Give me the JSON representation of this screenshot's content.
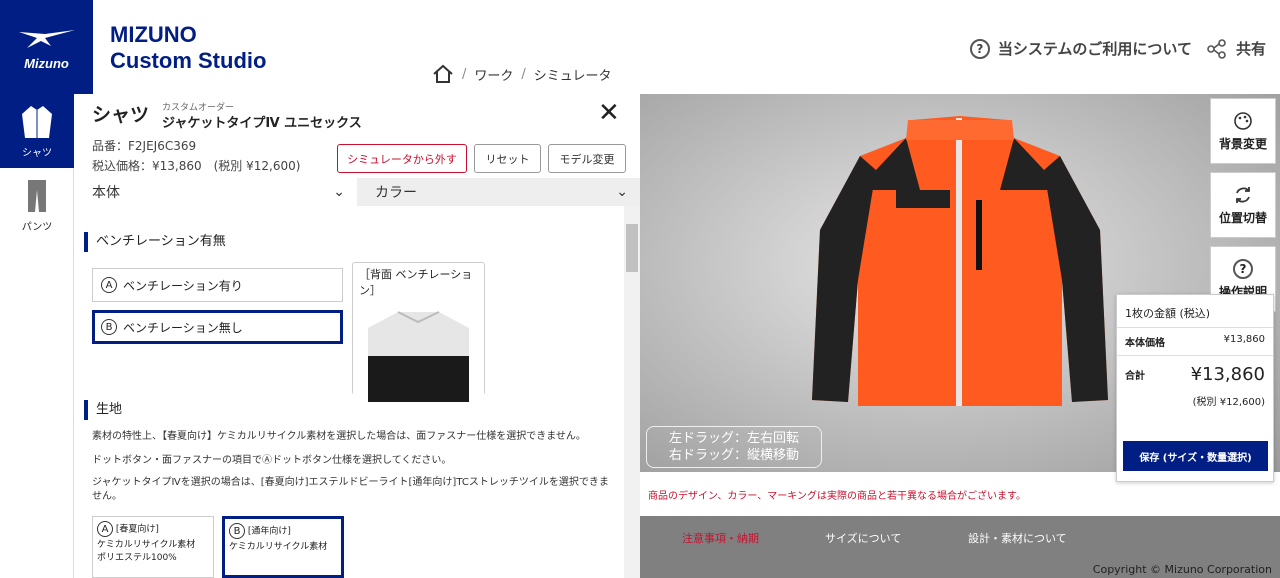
{
  "brand": {
    "logo_text": "Mizuno",
    "line1": "MIZUNO",
    "line2": "Custom Studio"
  },
  "breadcrumb": {
    "items": [
      "ワーク",
      "シミュレータ"
    ]
  },
  "header": {
    "help_label": "当システムのご利用について",
    "share_label": "共有"
  },
  "nav": {
    "items": [
      {
        "label": "シャツ",
        "icon": "shirt-icon"
      },
      {
        "label": "パンツ",
        "icon": "pants-icon"
      }
    ]
  },
  "product": {
    "category": "シャツ",
    "order_type": "カスタムオーダー",
    "name": "ジャケットタイプⅣ ユニセックス",
    "number": "品番：F2JEJ6C369",
    "price": "税込価格：¥13,860　(税別 ¥12,600)"
  },
  "buttons": {
    "remove": "シミュレータから外す",
    "reset": "リセット",
    "model_change": "モデル変更"
  },
  "selects": {
    "body": "本体",
    "color": "カラー"
  },
  "ventilation": {
    "title": "ベンチレーション有無",
    "option_a_mark": "A",
    "option_a": "ベンチレーション有り",
    "option_b_mark": "B",
    "option_b": "ベンチレーション無し",
    "image_caption": "［背面 ベンチレーション］"
  },
  "fabric": {
    "title": "生地",
    "note1": "素材の特性上、【春夏向け】ケミカルリサイクル素材を選択した場合は、面ファスナー仕様を選択できません。",
    "note2": "ドットボタン・面ファスナーの項目でⒶドットボタン仕様を選択してください。",
    "note3": "ジャケットタイプⅣを選択の場合は、[春夏向け]エステルドビーライト[通年向け]TCストレッチツイルを選択できません。",
    "card_a_mark": "A",
    "card_a_title": "[春夏向け]",
    "card_a_sub": "ケミカルリサイクル素材",
    "card_a_detail": "ポリエステル100%",
    "card_b_mark": "B",
    "card_b_title": "[通年向け]",
    "card_b_sub": "ケミカルリサイクル素材"
  },
  "viewer": {
    "hint_line1": "左ドラッグ：左右回転",
    "hint_line2": "右ドラッグ：縦横移動",
    "bg_change": "背景変更",
    "position_switch": "位置切替",
    "instructions": "操作説明"
  },
  "price_panel": {
    "header": "1枚の金額 (税込)",
    "base_label": "本体価格",
    "base_value": "¥13,860",
    "total_label": "合計",
    "total_value": "¥13,860",
    "tax_excl": "(税別 ¥12,600)",
    "save_button": "保存 (サイズ・数量選択)"
  },
  "disclaimer": "商品のデザイン、カラー、マーキングは実際の商品と若干異なる場合がございます。",
  "footer": {
    "links": [
      "注意事項・納期",
      "サイズについて",
      "設計・素材について"
    ],
    "copyright": "Copyright © Mizuno Corporation"
  },
  "colors": {
    "brand": "#001e84",
    "alert": "#c8102e",
    "jacket_orange": "#ff5a1f",
    "jacket_black": "#222222"
  }
}
